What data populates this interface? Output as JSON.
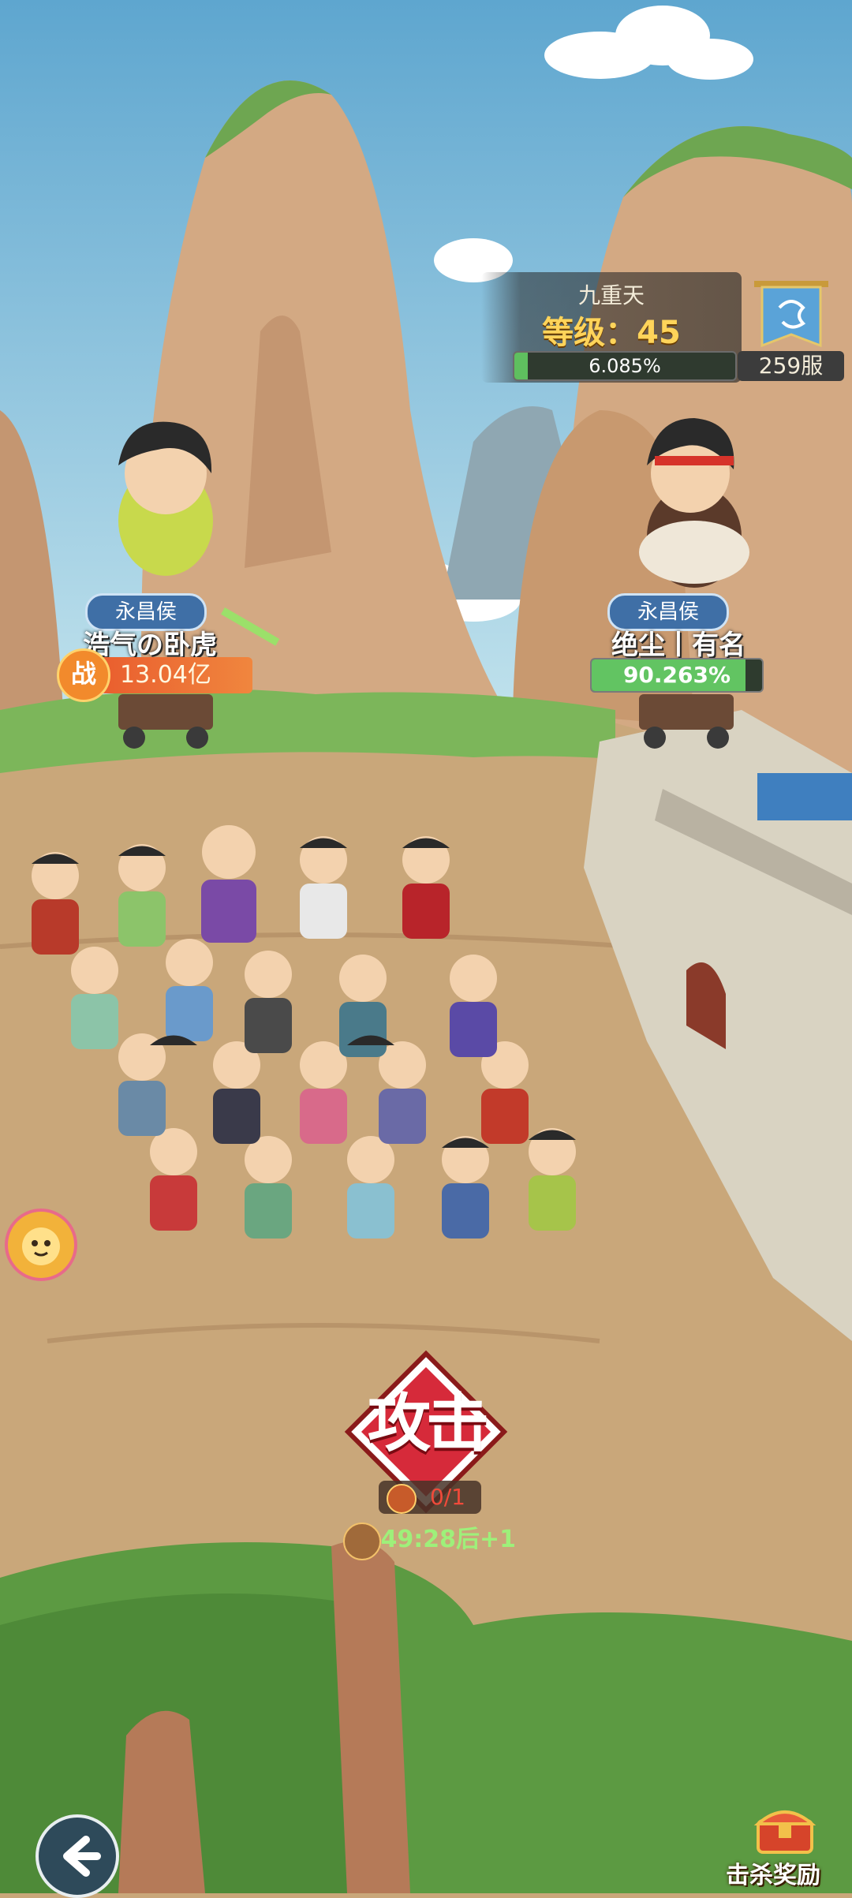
{
  "colors": {
    "sky": "#7fb8d6",
    "ground": "#c9a77a",
    "hp_green": "#62c462",
    "power_orange": "#e8542a",
    "level_gold": "#ffd45a"
  },
  "realm": {
    "name": "九重天",
    "level_label": "等级：45",
    "exp_percent": 6.085,
    "exp_text": "6.085%",
    "server": "259服"
  },
  "player": {
    "title": "永昌侯",
    "name": "浩气の卧虎",
    "power_icon": "战",
    "power": "13.04亿"
  },
  "opponent": {
    "title": "永昌侯",
    "name": "绝尘丨有名",
    "hp_percent": 90.263,
    "hp_text": "90.263%"
  },
  "attack": {
    "label": "攻击",
    "count": "0/1",
    "timer": "49:28后+1"
  },
  "bottom": {
    "reward_label": "击杀奖励"
  },
  "icons": {
    "server": "dragon-banner-icon",
    "back": "back-arrow-icon",
    "reward": "treasure-chest-icon",
    "pet": "pet-face-icon",
    "count": "attack-token-icon",
    "timer": "money-bag-icon"
  }
}
